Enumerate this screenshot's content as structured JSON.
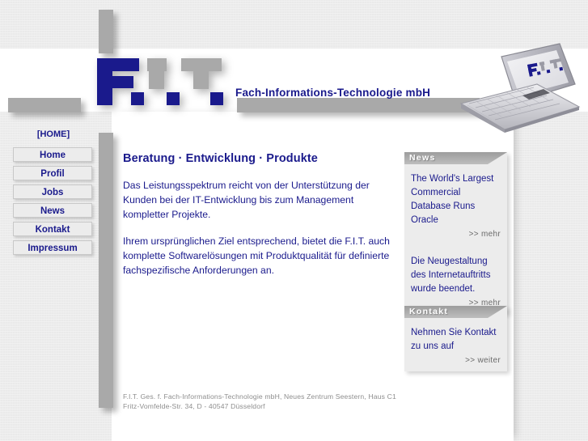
{
  "header": {
    "logo_text": "F.I.T.",
    "tagline": "Fach-Informations-Technologie mbH",
    "monitor_logo_text": "F.I.T.",
    "logo_navy": "#1a1a8c",
    "logo_gray": "#a9a9a9"
  },
  "nav": {
    "home_link": "[HOME]",
    "items": [
      {
        "label": "Home"
      },
      {
        "label": "Profil"
      },
      {
        "label": "Jobs"
      },
      {
        "label": "News"
      },
      {
        "label": "Kontakt"
      },
      {
        "label": "Impressum"
      }
    ]
  },
  "main": {
    "heading": "Beratung · Entwicklung · Produkte",
    "paragraph1": "Das Leistungsspektrum reicht von der Unterstützung der Kunden bei der IT-Entwicklung bis zum Management kompletter Projekte.",
    "paragraph2": "Ihrem ursprünglichen Ziel entsprechend, bietet die F.I.T. auch komplette Softwarelösungen mit Produktqualität für definierte fachspezifische Anforderungen an."
  },
  "news_box": {
    "title": "News",
    "items": [
      {
        "text": "The World's Largest Commercial Database Runs Oracle",
        "link_label": ">> mehr"
      },
      {
        "text": "Die Neugestaltung des Internetauftritts wurde beendet.",
        "link_label": ">> mehr"
      }
    ]
  },
  "kontakt_box": {
    "title": "Kontakt",
    "text": "Nehmen Sie Kontakt zu uns auf",
    "link_label": ">> weiter"
  },
  "footer": {
    "line1": "F.I.T. Ges. f. Fach-Informations-Technologie mbH, Neues Zentrum Seestern, Haus C1",
    "line2": "Fritz-Vomfelde-Str. 34, D - 40547 Düsseldorf"
  }
}
